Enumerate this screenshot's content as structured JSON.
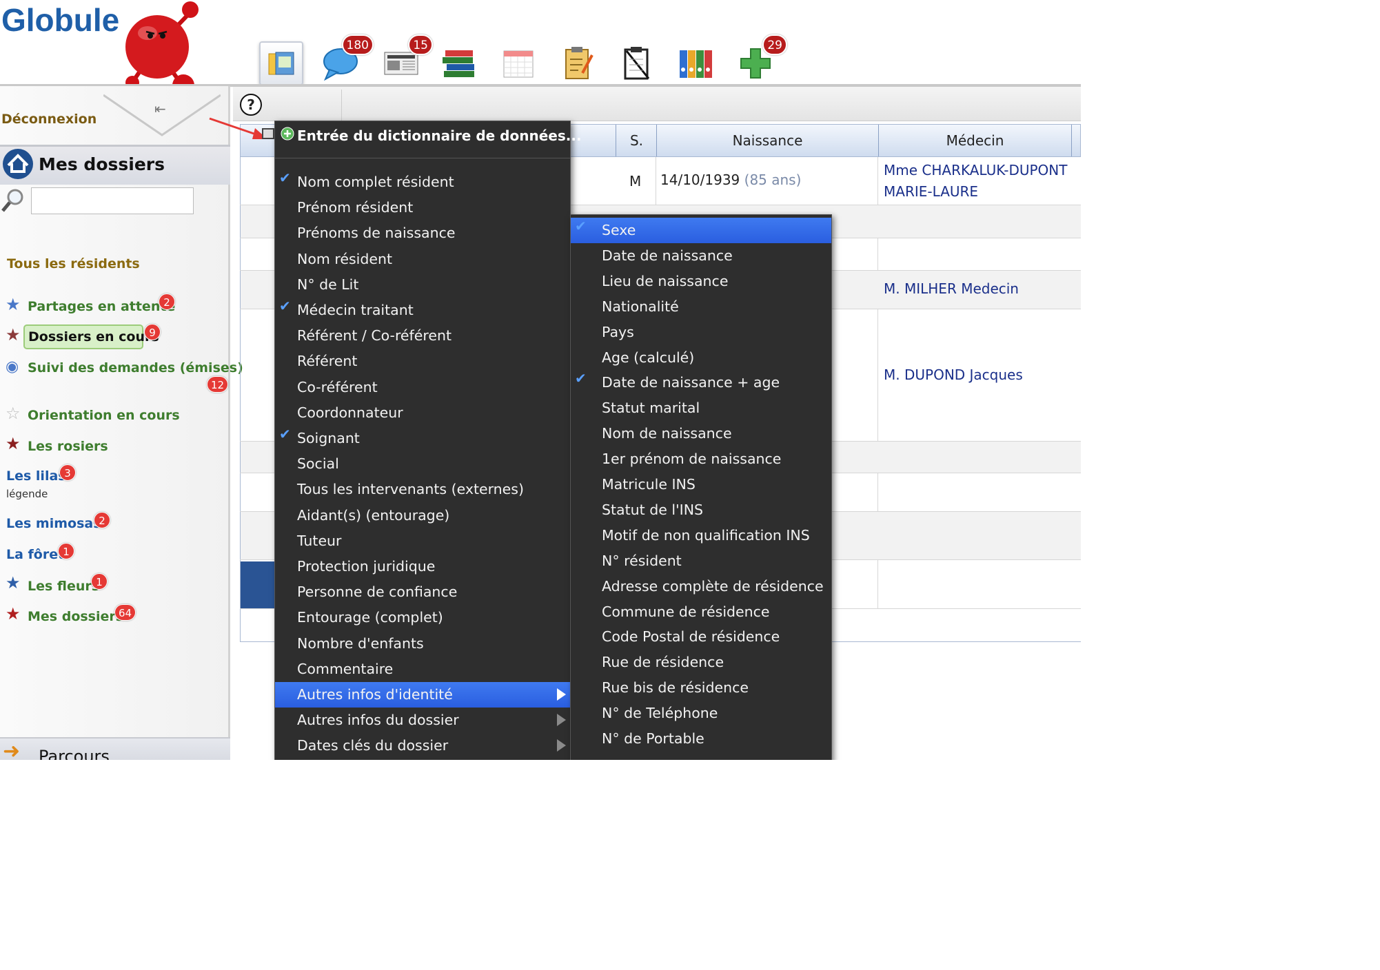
{
  "app": {
    "logo": "Globule"
  },
  "header": {
    "tools": [
      {
        "icon": "folder-icon",
        "badge": ""
      },
      {
        "icon": "chat-bubble-icon",
        "badge": "180"
      },
      {
        "icon": "newspaper-icon",
        "badge": "15"
      },
      {
        "icon": "books-icon",
        "badge": ""
      },
      {
        "icon": "calendar-icon",
        "badge": ""
      },
      {
        "icon": "clipboard-icon",
        "badge": ""
      },
      {
        "icon": "checklist-icon",
        "badge": ""
      },
      {
        "icon": "binders-icon",
        "badge": ""
      },
      {
        "icon": "medical-cross-icon",
        "badge": "29"
      }
    ]
  },
  "sidebar": {
    "logout": "Déconnexion",
    "title": "Mes dossiers",
    "search_placeholder": "",
    "all_residents": "Tous les résidents",
    "items": [
      {
        "label": "Partages en attente",
        "badge": "2"
      },
      {
        "label": "Dossiers en cours",
        "badge": "9"
      },
      {
        "label": "Suivi des demandes (émises)",
        "badge": "12"
      },
      {
        "label": "Orientation en cours",
        "badge": ""
      },
      {
        "label": "Les rosiers",
        "badge": ""
      },
      {
        "label": "Les lilas",
        "badge": "3",
        "sub": "légende"
      },
      {
        "label": "Les mimosas",
        "badge": "2"
      },
      {
        "label": "La fôret",
        "badge": "1"
      },
      {
        "label": "Les fleurs",
        "badge": "1"
      },
      {
        "label": "Mes dossiers",
        "badge": "64"
      }
    ],
    "bottom": "Parcours"
  },
  "grid": {
    "help": "?",
    "columns": [
      "S.",
      "Naissance",
      "Médecin"
    ],
    "row1": {
      "sex": "M",
      "birth": "14/10/1939",
      "age": "(85 ans)",
      "doctor_line1": "Mme CHARKALUK-DUPONT",
      "doctor_line2": "MARIE-LAURE"
    },
    "row4": {
      "doctor": "M. MILHER Medecin"
    },
    "row5": {
      "doctor": "M. DUPOND Jacques"
    }
  },
  "menu": {
    "header": "Entrée du dictionnaire de données...",
    "items": [
      {
        "label": "Nom complet résident",
        "checked": true
      },
      {
        "label": "Prénom résident"
      },
      {
        "label": "Prénoms de naissance"
      },
      {
        "label": "Nom résident"
      },
      {
        "label": "N° de Lit"
      },
      {
        "label": "Médecin traitant",
        "checked": true
      },
      {
        "label": "Référent / Co-référent"
      },
      {
        "label": "Référent"
      },
      {
        "label": "Co-référent"
      },
      {
        "label": "Coordonnateur"
      },
      {
        "label": "Soignant",
        "checked": true
      },
      {
        "label": "Social"
      },
      {
        "label": "Tous les intervenants (externes)"
      },
      {
        "label": "Aidant(s) (entourage)"
      },
      {
        "label": "Tuteur"
      },
      {
        "label": "Protection juridique"
      },
      {
        "label": "Personne de confiance"
      },
      {
        "label": "Entourage (complet)"
      },
      {
        "label": "Nombre d'enfants"
      },
      {
        "label": "Commentaire"
      },
      {
        "label": "Autres infos d'identité",
        "selected": true,
        "submenu": true
      },
      {
        "label": "Autres infos du dossier",
        "submenu": true
      },
      {
        "label": "Dates clés du dossier",
        "submenu": true
      }
    ]
  },
  "submenu": {
    "items": [
      {
        "label": "Sexe",
        "checked": true,
        "selected": true
      },
      {
        "label": "Date de naissance"
      },
      {
        "label": "Lieu de naissance"
      },
      {
        "label": "Nationalité"
      },
      {
        "label": "Pays"
      },
      {
        "label": "Age (calculé)"
      },
      {
        "label": "Date de naissance + age",
        "checked": true
      },
      {
        "label": "Statut marital"
      },
      {
        "label": "Nom de naissance"
      },
      {
        "label": "1er prénom de naissance"
      },
      {
        "label": "Matricule INS"
      },
      {
        "label": "Statut de l'INS"
      },
      {
        "label": "Motif de non qualification INS"
      },
      {
        "label": "N° résident"
      },
      {
        "label": "Adresse complète de résidence"
      },
      {
        "label": "Commune de résidence"
      },
      {
        "label": "Code Postal de résidence"
      },
      {
        "label": "Rue de résidence"
      },
      {
        "label": "Rue bis de résidence"
      },
      {
        "label": "N° de Teléphone"
      },
      {
        "label": "N° de Portable"
      }
    ]
  },
  "colors": {
    "accent": "#2a5ee0",
    "menu_bg": "#2e2e2e",
    "badge": "#e53935",
    "logo": "#1f5fa8"
  }
}
